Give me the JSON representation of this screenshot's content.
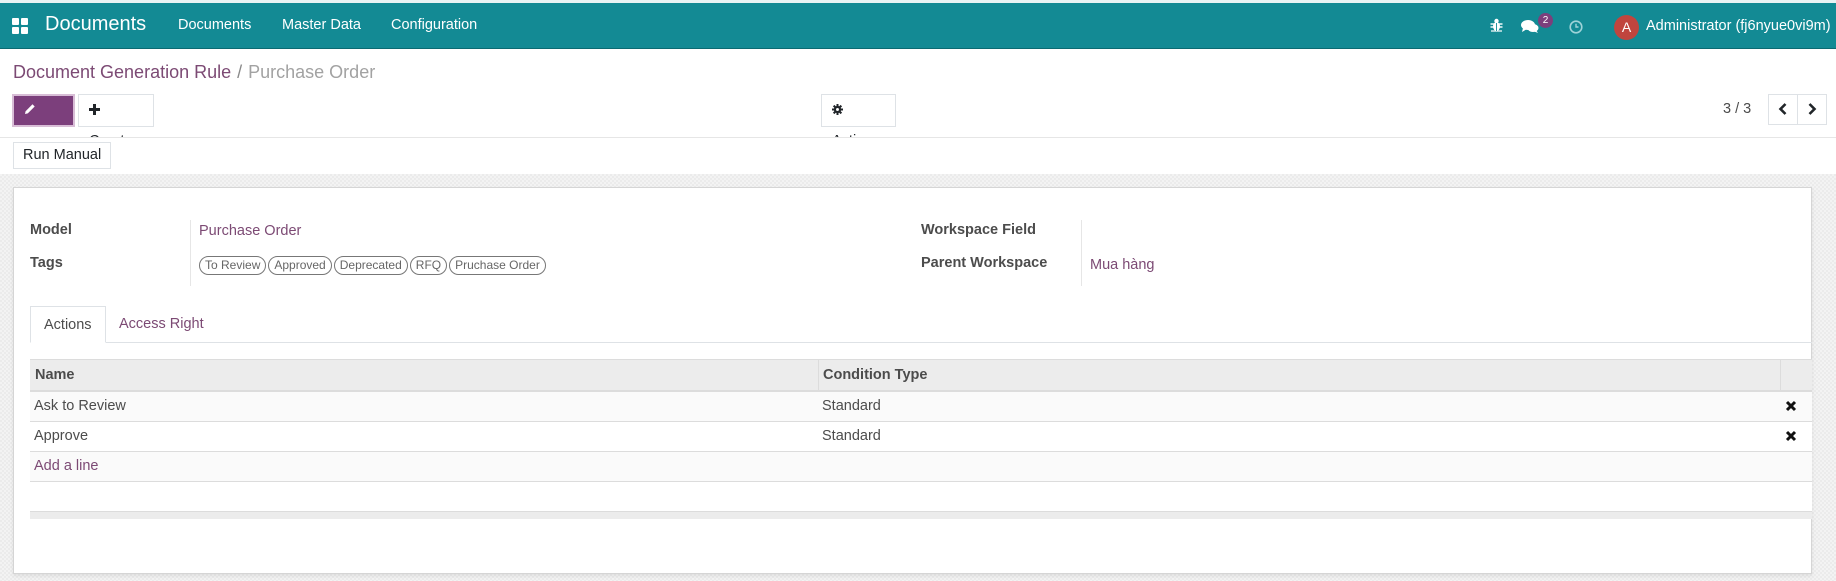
{
  "navbar": {
    "app_icon": "apps-grid-icon",
    "brand": "Documents",
    "menu": [
      "Documents",
      "Master Data",
      "Configuration"
    ],
    "icons": [
      "bug-icon",
      "chat-icon",
      "clock-icon"
    ],
    "messages_badge": "2",
    "avatar_initial": "A",
    "user_name": "Administrator (fj6nyue0vi9m)"
  },
  "breadcrumb": {
    "parent": "Document Generation Rule",
    "separator": "/",
    "current": "Purchase Order"
  },
  "toolbar": {
    "edit_label": "Edit",
    "create_label": "Create",
    "action_label": "Action",
    "run_manual_label": "Run Manual"
  },
  "pager": {
    "value": "3 / 3",
    "prev_icon": "chevron-left-icon",
    "next_icon": "chevron-right-icon"
  },
  "form": {
    "model_label": "Model",
    "model_value": "Purchase Order",
    "tags_label": "Tags",
    "tags": [
      "To Review",
      "Approved",
      "Deprecated",
      "RFQ",
      "Pruchase Order"
    ],
    "workspace_field_label": "Workspace Field",
    "workspace_field_value": "",
    "parent_workspace_label": "Parent Workspace",
    "parent_workspace_value": "Mua hàng"
  },
  "tabs": [
    {
      "label": "Actions",
      "active": true
    },
    {
      "label": "Access Right",
      "active": false
    }
  ],
  "actions_table": {
    "columns": [
      "Name",
      "Condition Type"
    ],
    "rows": [
      {
        "name": "Ask to Review",
        "condition_type": "Standard"
      },
      {
        "name": "Approve",
        "condition_type": "Standard"
      }
    ],
    "add_line_label": "Add a line"
  },
  "colors": {
    "navbar": "#138a94",
    "primary": "#7c3f7c",
    "link": "#7c4a74",
    "avatar": "#c0453e"
  }
}
